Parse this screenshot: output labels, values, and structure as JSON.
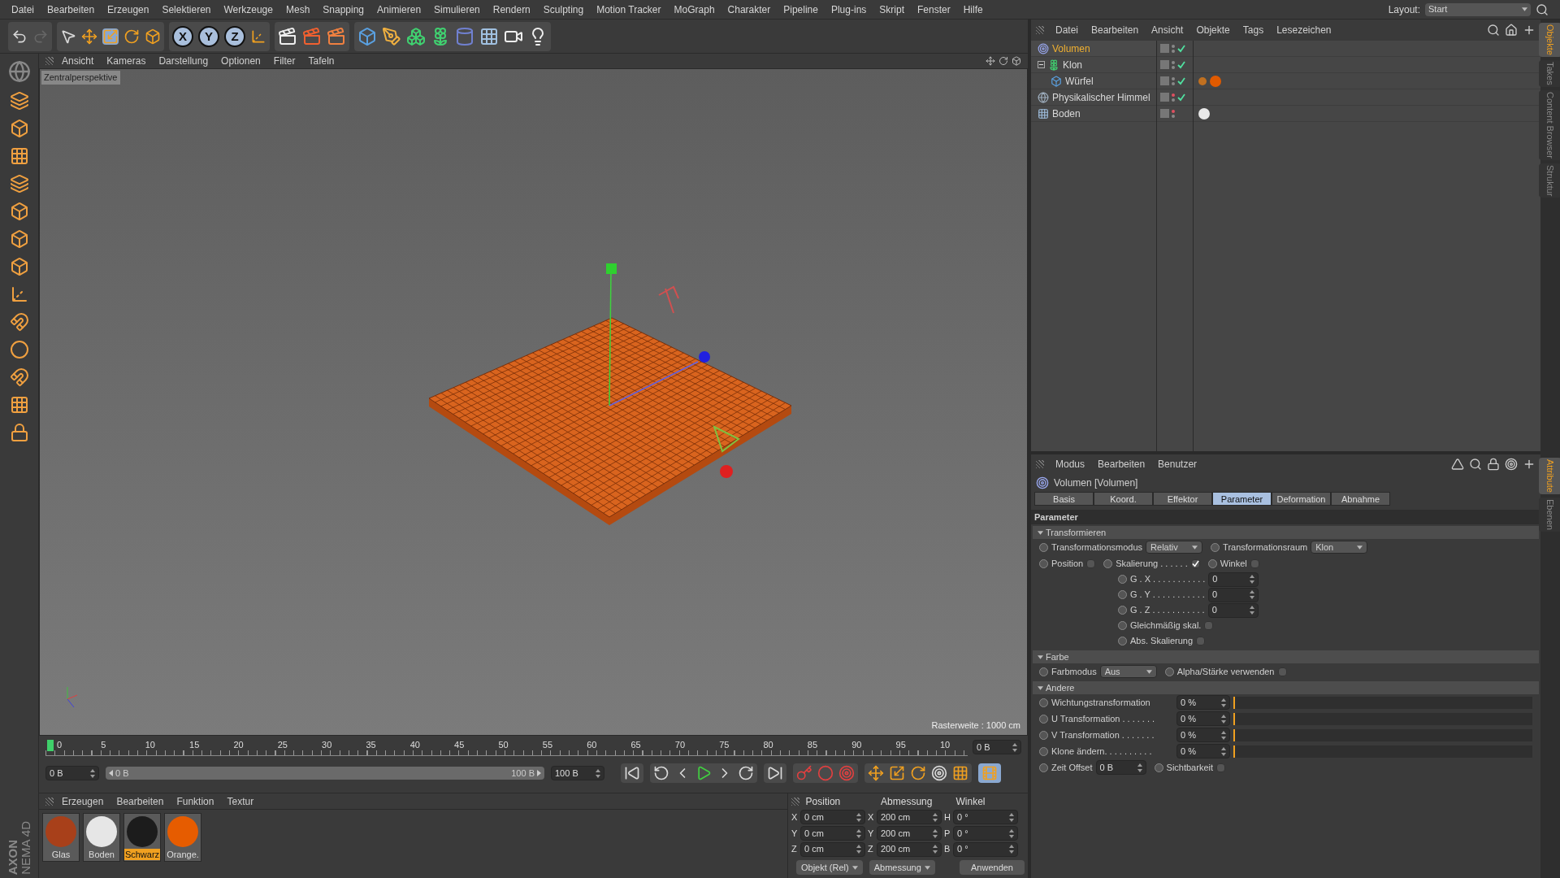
{
  "menu_bar": {
    "items": [
      "Datei",
      "Bearbeiten",
      "Erzeugen",
      "Selektieren",
      "Werkzeuge",
      "Mesh",
      "Snapping",
      "Animieren",
      "Simulieren",
      "Rendern",
      "Sculpting",
      "Motion Tracker",
      "MoGraph",
      "Charakter",
      "Pipeline",
      "Plug-ins",
      "Skript",
      "Fenster",
      "Hilfe"
    ],
    "layout_label": "Layout:",
    "layout_value": "Start"
  },
  "toolbar": {
    "axis_buttons": [
      "X",
      "Y",
      "Z"
    ]
  },
  "viewport": {
    "menu": [
      "Ansicht",
      "Kameras",
      "Darstellung",
      "Optionen",
      "Filter",
      "Tafeln"
    ],
    "camera": "Zentralperspektive",
    "grid_spacing": "Rasterweite : 1000 cm"
  },
  "object_manager": {
    "menu": [
      "Datei",
      "Bearbeiten",
      "Ansicht",
      "Objekte",
      "Tags",
      "Lesezeichen"
    ],
    "objects": [
      {
        "name": "Volumen",
        "kind": "effector",
        "selected": true,
        "visibility_off": false,
        "enabled": true
      },
      {
        "name": "Klon",
        "kind": "cloner",
        "selected": false,
        "visibility_off": false,
        "enabled": true,
        "expanded": true,
        "children": [
          {
            "name": "Würfel",
            "kind": "cube",
            "selected": false,
            "visibility_off": false,
            "enabled": true,
            "tags": [
              {
                "kind": "phong",
                "color": "#c07020"
              },
              {
                "kind": "material",
                "color": "#e05a00"
              }
            ]
          }
        ]
      },
      {
        "name": "Physikalischer Himmel",
        "kind": "sky",
        "selected": false,
        "visibility_off": true,
        "enabled": true
      },
      {
        "name": "Boden",
        "kind": "floor",
        "selected": false,
        "visibility_off": true,
        "enabled": false,
        "tags": [
          {
            "kind": "material",
            "color": "#e8e8e8"
          }
        ]
      }
    ]
  },
  "side_tabs_top": [
    {
      "label": "Objekte",
      "selected": true
    },
    {
      "label": "Takes",
      "selected": false
    },
    {
      "label": "Content Browser",
      "selected": false
    },
    {
      "label": "Struktur",
      "selected": false
    }
  ],
  "attributes": {
    "menu": [
      "Modus",
      "Bearbeiten",
      "Benutzer"
    ],
    "title": "Volumen [Volumen]",
    "tabs": [
      {
        "label": "Basis",
        "selected": false
      },
      {
        "label": "Koord.",
        "selected": false
      },
      {
        "label": "Effektor",
        "selected": false
      },
      {
        "label": "Parameter",
        "selected": true
      },
      {
        "label": "Deformation",
        "selected": false
      },
      {
        "label": "Abnahme",
        "selected": false
      }
    ],
    "section": "Parameter",
    "groups": [
      {
        "title": "Transformieren",
        "rows": [
          {
            "items": [
              {
                "kind": "dropdown",
                "label": "Transformationsmodus",
                "value": "Relativ"
              },
              {
                "kind": "dropdown",
                "label": "Transformationsraum",
                "value": "Klon"
              }
            ]
          },
          {
            "items": [
              {
                "kind": "check",
                "label": "Position",
                "checked": false
              },
              {
                "kind": "check",
                "label": "Skalierung . . . . . .",
                "checked": true,
                "children": [
                  {
                    "kind": "number",
                    "label": "G . X . . . . . . . . . . .",
                    "value": "0"
                  },
                  {
                    "kind": "number",
                    "label": "G . Y . . . . . . . . . . .",
                    "value": "0"
                  },
                  {
                    "kind": "number",
                    "label": "G . Z . . . . . . . . . . .",
                    "value": "0"
                  },
                  {
                    "kind": "check",
                    "label": "Gleichmäßig skal.",
                    "checked": false
                  },
                  {
                    "kind": "check",
                    "label": "Abs. Skalierung",
                    "checked": false
                  }
                ]
              },
              {
                "kind": "check",
                "label": "Winkel",
                "checked": false
              }
            ]
          }
        ]
      },
      {
        "title": "Farbe",
        "rows": [
          {
            "items": [
              {
                "kind": "dropdown",
                "label": "Farbmodus",
                "value": "Aus"
              },
              {
                "kind": "check",
                "label": "Alpha/Stärke verwenden",
                "checked": false
              }
            ]
          }
        ]
      },
      {
        "title": "Andere",
        "rows": [
          {
            "items": [
              {
                "kind": "slider",
                "label": "Wichtungstransformation",
                "value": "0 %",
                "level": 0
              }
            ]
          },
          {
            "items": [
              {
                "kind": "slider",
                "label": "U Transformation . . . . . . .",
                "value": "0 %",
                "level": 0
              }
            ]
          },
          {
            "items": [
              {
                "kind": "slider",
                "label": "V Transformation . . . . . . .",
                "value": "0 %",
                "level": 0
              }
            ]
          },
          {
            "items": [
              {
                "kind": "slider",
                "label": "Klone ändern. . . . . . . . . .",
                "value": "0 %",
                "level": 0
              }
            ]
          },
          {
            "items": [
              {
                "kind": "number",
                "label": "Zeit Offset",
                "value": "0 B"
              },
              {
                "kind": "check",
                "label": "Sichtbarkeit",
                "checked": false
              }
            ]
          }
        ]
      }
    ]
  },
  "side_tabs_bottom": [
    {
      "label": "Attribute",
      "selected": true
    },
    {
      "label": "Ebenen",
      "selected": false
    }
  ],
  "timeline": {
    "ticks": [
      "0",
      "5",
      "10",
      "15",
      "20",
      "25",
      "30",
      "35",
      "40",
      "45",
      "50",
      "55",
      "60",
      "65",
      "70",
      "75",
      "80",
      "85",
      "90",
      "95",
      "10"
    ],
    "level": 0,
    "current_frame": "0 B",
    "start": "0 B",
    "range": {
      "start": "0 B",
      "end": "100 B",
      "level": 1
    },
    "end": "100 B"
  },
  "materials": {
    "menu": [
      "Erzeugen",
      "Bearbeiten",
      "Funktion",
      "Textur"
    ],
    "items": [
      {
        "name": "Glas",
        "color": "#a8401a",
        "selected": false
      },
      {
        "name": "Boden",
        "color": "#e6e6e6",
        "selected": false
      },
      {
        "name": "Schwarz",
        "color": "#1c1c1c",
        "selected": true
      },
      {
        "name": "Orange.",
        "color": "#e65c00",
        "selected": false
      }
    ]
  },
  "coordinates": {
    "headers": [
      "Position",
      "Abmessung",
      "Winkel"
    ],
    "rows": [
      {
        "axis": "X",
        "position": "0 cm",
        "size_axis": "X",
        "size": "200 cm",
        "angle_axis": "H",
        "angle": "0 °"
      },
      {
        "axis": "Y",
        "position": "0 cm",
        "size_axis": "Y",
        "size": "200 cm",
        "angle_axis": "P",
        "angle": "0 °"
      },
      {
        "axis": "Z",
        "position": "0 cm",
        "size_axis": "Z",
        "size": "200 cm",
        "angle_axis": "B",
        "angle": "0 °"
      }
    ],
    "mode": "Objekt (Rel)",
    "size_mode": "Abmessung",
    "apply": "Anwenden"
  },
  "brand": [
    "AXON",
    "NEMA 4D"
  ]
}
